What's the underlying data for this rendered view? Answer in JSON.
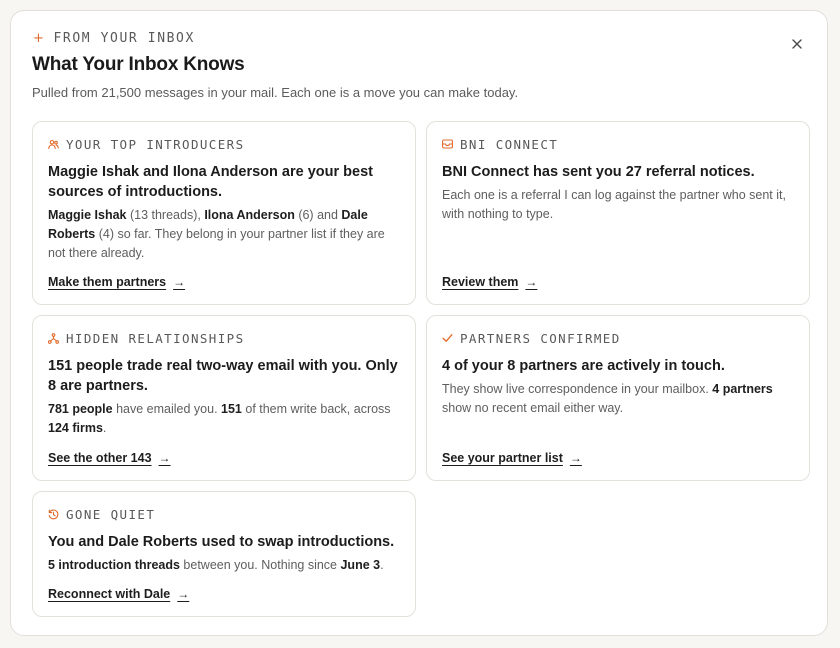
{
  "header": {
    "eyebrow": "FROM YOUR INBOX",
    "title": "What Your Inbox Knows",
    "subtitle": "Pulled from 21,500 messages in your mail. Each one is a move you can make today."
  },
  "accent_color": "#e26a2c",
  "cards": [
    {
      "icon": "people-icon",
      "label": "YOUR TOP INTRODUCERS",
      "headline": "Maggie Ishak and Ilona Anderson are your best sources of introductions.",
      "body": [
        {
          "t": "Maggie Ishak",
          "b": true
        },
        {
          "t": " (13 threads), ",
          "b": false
        },
        {
          "t": "Ilona Anderson",
          "b": true
        },
        {
          "t": " (6) and ",
          "b": false
        },
        {
          "t": "Dale Roberts",
          "b": true
        },
        {
          "t": " (4) so far. They belong in your partner list if they are not there already.",
          "b": false
        }
      ],
      "link": "Make them partners"
    },
    {
      "icon": "mail-icon",
      "label": "BNI CONNECT",
      "headline": "BNI Connect has sent you 27 referral notices.",
      "body": [
        {
          "t": "Each one is a referral I can log against the partner who sent it, with nothing to type.",
          "b": false
        }
      ],
      "link": "Review them"
    },
    {
      "icon": "network-icon",
      "label": "HIDDEN RELATIONSHIPS",
      "headline": "151 people trade real two-way email with you. Only 8 are partners.",
      "body": [
        {
          "t": "781 people",
          "b": true
        },
        {
          "t": " have emailed you. ",
          "b": false
        },
        {
          "t": "151",
          "b": true
        },
        {
          "t": " of them write back, across ",
          "b": false
        },
        {
          "t": "124 firms",
          "b": true
        },
        {
          "t": ".",
          "b": false
        }
      ],
      "link": "See the other 143"
    },
    {
      "icon": "check-icon",
      "label": "PARTNERS CONFIRMED",
      "headline": "4 of your 8 partners are actively in touch.",
      "body": [
        {
          "t": "They show live correspondence in your mailbox. ",
          "b": false
        },
        {
          "t": "4 partners",
          "b": true
        },
        {
          "t": " show no recent email either way.",
          "b": false
        }
      ],
      "link": "See your partner list"
    },
    {
      "icon": "history-icon",
      "label": "GONE QUIET",
      "headline": "You and Dale Roberts used to swap introductions.",
      "body": [
        {
          "t": "5 introduction threads",
          "b": true
        },
        {
          "t": " between you. Nothing since ",
          "b": false
        },
        {
          "t": "June 3",
          "b": true
        },
        {
          "t": ".",
          "b": false
        }
      ],
      "link": "Reconnect with Dale"
    }
  ]
}
